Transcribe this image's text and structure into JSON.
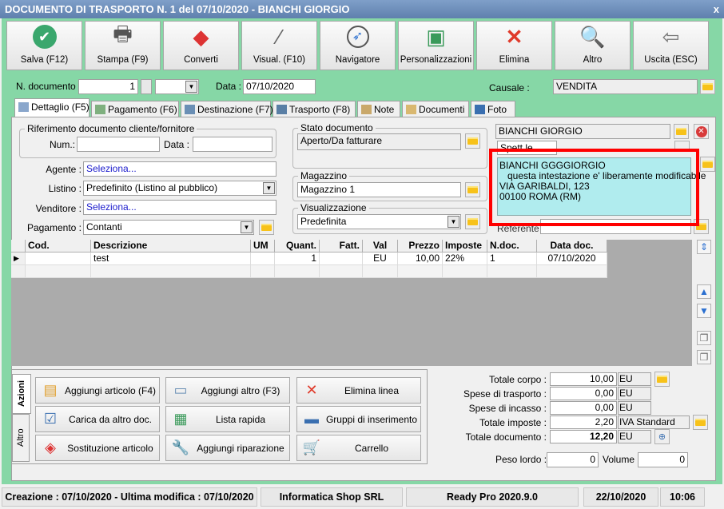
{
  "window": {
    "title": "DOCUMENTO DI TRASPORTO N. 1 del 07/10/2020 - BIANCHI GIORGIO",
    "close": "x"
  },
  "toolbar": [
    {
      "label": "Salva (F12)",
      "icon": "check-circle-icon"
    },
    {
      "label": "Stampa (F9)",
      "icon": "printer-icon"
    },
    {
      "label": "Converti",
      "icon": "convert-icon"
    },
    {
      "label": "Visual. (F10)",
      "icon": "magic-wand-icon"
    },
    {
      "label": "Navigatore",
      "icon": "compass-icon"
    },
    {
      "label": "Personalizzazioni",
      "icon": "squares-icon"
    },
    {
      "label": "Elimina",
      "icon": "red-x-icon"
    },
    {
      "label": "Altro",
      "icon": "magnifier-book-icon"
    },
    {
      "label": "Uscita (ESC)",
      "icon": "exit-door-icon"
    }
  ],
  "header": {
    "ndoc_label": "N. documento :",
    "ndoc_value": "1",
    "data_label": "Data :",
    "data_value": "07/10/2020",
    "causale_label": "Causale :",
    "causale_value": "VENDITA"
  },
  "tabs": [
    "Dettaglio (F5)",
    "Pagamento (F6)",
    "Destinazione (F7)",
    "Trasporto (F8)",
    "Note",
    "Documenti",
    "Foto"
  ],
  "riferimento": {
    "title": "Riferimento documento cliente/fornitore",
    "num_label": "Num.:",
    "num_value": "",
    "data_label": "Data :",
    "data_value": ""
  },
  "fields": {
    "agente_label": "Agente :",
    "agente_value": "Seleziona...",
    "listino_label": "Listino :",
    "listino_value": "Predefinito (Listino al pubblico)",
    "venditore_label": "Venditore :",
    "venditore_value": "Seleziona...",
    "pagamento_label": "Pagamento :",
    "pagamento_value": "Contanti"
  },
  "stato": {
    "title": "Stato documento",
    "value": "Aperto/Da fatturare"
  },
  "magazzino": {
    "title": "Magazzino",
    "value": "Magazzino 1"
  },
  "visualizzazione": {
    "title": "Visualizzazione",
    "value": "Predefinita"
  },
  "cliente": {
    "name": "BIANCHI GIORGIO",
    "spett": "Spett.le",
    "address_lines": [
      "BIANCHI GGGGIORGIO",
      "   questa intestazione e' liberamente modificabile",
      "VIA GARIBALDI, 123",
      "00100 ROMA (RM)"
    ],
    "referente_label": "Referente",
    "referente_value": "",
    "highlight_color": "#ff0000",
    "box_color": "#b0ecee"
  },
  "grid": {
    "columns": [
      "Cod.",
      "Descrizione",
      "UM",
      "Quant.",
      "Fatt.",
      "Val",
      "Prezzo",
      "Imposte",
      "N.doc.",
      "Data doc."
    ],
    "rows": [
      [
        "",
        "test",
        "",
        "1",
        "",
        "EU",
        "10,00",
        "22%",
        "1",
        "07/10/2020"
      ]
    ]
  },
  "actions": {
    "tabs": [
      "Azioni",
      "Altro"
    ],
    "buttons": [
      {
        "label": "Aggiungi articolo (F4)",
        "icon": "add-article-icon"
      },
      {
        "label": "Aggiungi altro (F3)",
        "icon": "add-other-icon"
      },
      {
        "label": "Elimina linea",
        "icon": "red-x-icon"
      },
      {
        "label": "Carica da altro doc.",
        "icon": "load-doc-icon"
      },
      {
        "label": "Lista rapida",
        "icon": "quick-list-icon"
      },
      {
        "label": "Gruppi di inserimento",
        "icon": "insert-group-icon"
      },
      {
        "label": "Sostituzione articolo",
        "icon": "replace-icon"
      },
      {
        "label": "Aggiungi riparazione",
        "icon": "wrench-icon"
      },
      {
        "label": "Carrello",
        "icon": "cart-icon"
      }
    ]
  },
  "totals": [
    {
      "label": "Totale corpo :",
      "value": "10,00",
      "unit": "EU"
    },
    {
      "label": "Spese di trasporto :",
      "value": "0,00",
      "unit": "EU"
    },
    {
      "label": "Spese di incasso :",
      "value": "0,00",
      "unit": "EU"
    },
    {
      "label": "Totale imposte :",
      "value": "2,20",
      "unit": "IVA Standard"
    },
    {
      "label": "Totale documento :",
      "value": "12,20",
      "unit": "EU"
    }
  ],
  "peso": {
    "label": "Peso lordo :",
    "value": "0",
    "volume_label": "Volume :",
    "volume_value": "0"
  },
  "status": {
    "creazione": "Creazione : 07/10/2020 - Ultima modifica : 07/10/2020",
    "company": "Informatica Shop SRL",
    "version": "Ready Pro 2020.9.0",
    "date": "22/10/2020",
    "time": "10:06"
  }
}
